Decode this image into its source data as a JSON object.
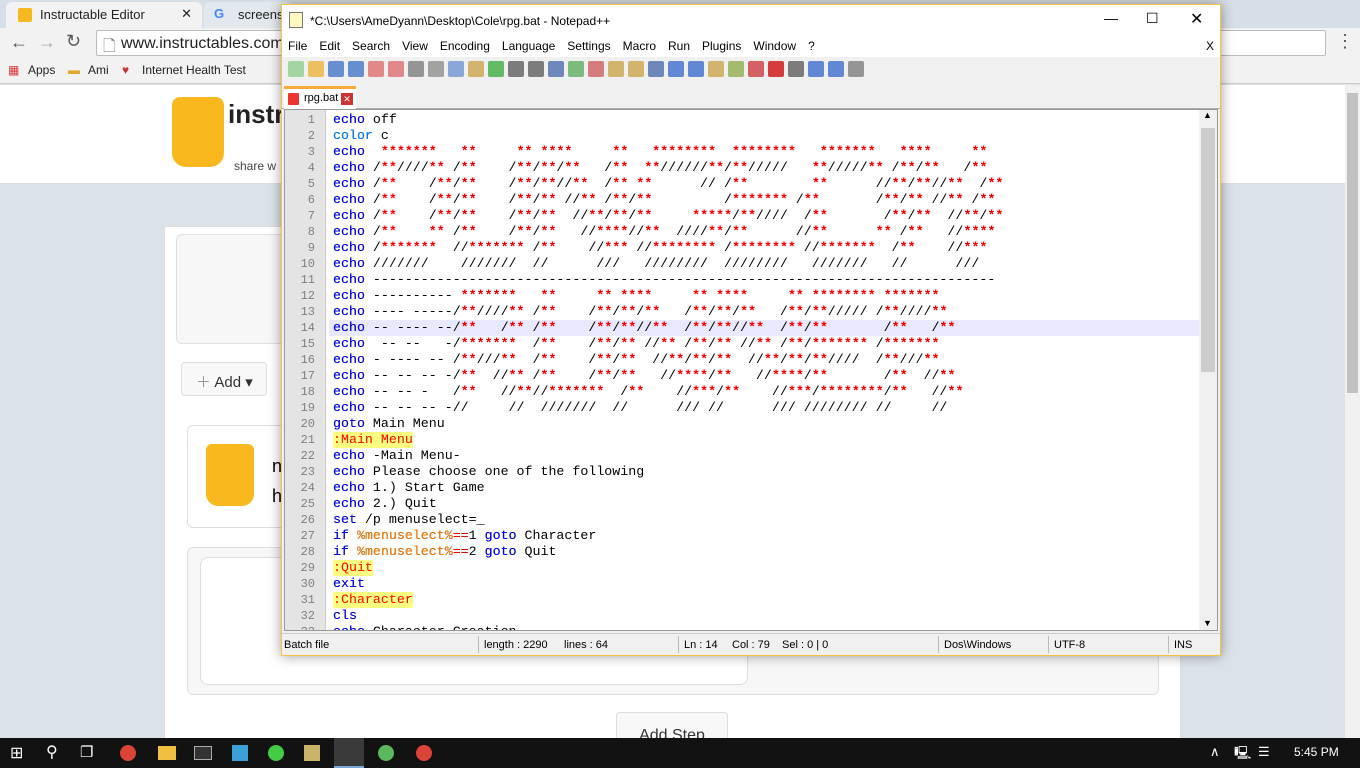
{
  "browser": {
    "tabs": [
      {
        "label": "Instructable Editor"
      },
      {
        "label": "screensho"
      }
    ],
    "url": "www.instructables.com",
    "bookmarks": [
      "Apps",
      "Ami",
      "Internet Health Test"
    ],
    "page": {
      "logo_text": "instr",
      "tagline": "share w",
      "add_button": "Add",
      "add_step_button": "Add Step",
      "snippet1": "n",
      "snippet2": "h"
    }
  },
  "notepad": {
    "title": "*C:\\Users\\AmeDyann\\Desktop\\Cole\\rpg.bat - Notepad++",
    "menu": [
      "File",
      "Edit",
      "Search",
      "View",
      "Encoding",
      "Language",
      "Settings",
      "Macro",
      "Run",
      "Plugins",
      "Window",
      "?"
    ],
    "menu_close": "X",
    "tab": "rpg.bat",
    "current_line": 14,
    "code": [
      "echo off",
      "color c",
      "echo  *******   **     ** ****     **   ********  ********   *******   ****     **",
      "echo /**////** /**    /**/**/**   /**  **//////**/**/////   **/////** /**/**   /**",
      "echo /**    /**/**    /**/**//**  /** **      // /**        **      //**/**//**  /**",
      "echo /**    /**/**    /**/** //** /**/**         /******* /**       /**/** //** /**",
      "echo /**    /**/**    /**/**  //**/**/**     *****/**////  /**       /**/**  //**/**",
      "echo /**    ** /**    /**/**   //****//**  ////**/**      //**      ** /**   //****",
      "echo /*******  //******* /**    //*** //******** /******** //*******  /**    //***",
      "echo ///////    ///////  //      ///   ////////  ////////   ///////   //      ///",
      "echo ------------------------------------------------------------------------------",
      "echo ---------- *******   **     ** ****     ** ****     ** ******** *******",
      "echo ---- -----/**////** /**    /**/**/**   /**/**/**   /**/**///// /**////**",
      "echo -- ---- --/**   /** /**    /**/**//**  /**/**//**  /**/**       /**   /**",
      "echo  -- --   -/*******  /**    /**/** //** /**/** //** /**/******* /*******",
      "echo - ---- -- /**///**  /**    /**/**  //**/**/**  //**/**/**////  /**///**",
      "echo -- -- -- -/**  //** /**    /**/**   //****/**   //****/**       /**  //**",
      "echo -- -- -   /**   //**//*******  /**    //***/**    //***/********/**   //**",
      "echo -- -- -- -//     //  ///////  //      /// //      /// //////// //     //",
      "goto Main Menu",
      ":Main Menu",
      "echo -Main Menu-",
      "echo Please choose one of the following",
      "echo 1.) Start Game",
      "echo 2.) Quit",
      "set /p menuselect=_",
      "if %menuselect%==1 goto Character",
      "if %menuselect%==2 goto Quit",
      ":Quit",
      "exit",
      ":Character",
      "cls",
      "echo Character Creation"
    ],
    "status": {
      "type": "Batch file",
      "length": "length : 2290",
      "lines": "lines : 64",
      "ln": "Ln : 14",
      "col": "Col : 79",
      "sel": "Sel : 0 | 0",
      "eol": "Dos\\Windows",
      "encoding": "UTF-8",
      "mode": "INS"
    }
  },
  "taskbar": {
    "time": "5:45 PM"
  },
  "colors": {
    "keyword": "#0000ff",
    "art_star": "#ff0000",
    "label_bg": "#ffff80",
    "variable": "#ff8000",
    "accent": "#f9a83b"
  }
}
